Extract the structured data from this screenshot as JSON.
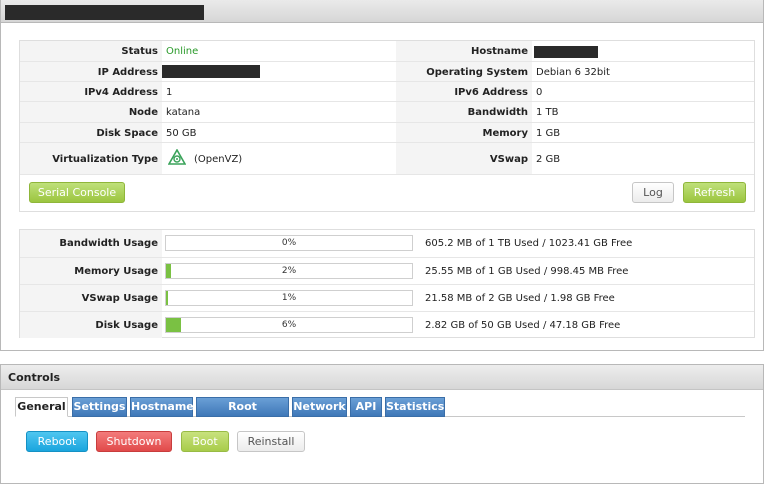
{
  "status": {
    "labels": {
      "status": "Status",
      "ip": "IP Address",
      "ipv4": "IPv4 Address",
      "node": "Node",
      "disk": "Disk Space",
      "virt": "Virtualization Type",
      "hostname": "Hostname",
      "os": "Operating System",
      "ipv6": "IPv6 Address",
      "bandwidth": "Bandwidth",
      "memory": "Memory",
      "vswap": "VSwap"
    },
    "values": {
      "status": "Online",
      "ipv4": "1",
      "node": "katana",
      "disk": "50 GB",
      "virt": "(OpenVZ)",
      "os": "Debian 6 32bit",
      "ipv6": "0",
      "bandwidth": "1 TB",
      "memory": "1 GB",
      "vswap": "2 GB"
    },
    "colors": {
      "online": "#2a9a2a"
    }
  },
  "buttons": {
    "serial_console": "Serial Console",
    "log": "Log",
    "refresh": "Refresh"
  },
  "usage": [
    {
      "label": "Bandwidth Usage",
      "percent_text": "0%",
      "fraction": 0.0,
      "detail": "605.2 MB of 1 TB Used / 1023.41 GB Free"
    },
    {
      "label": "Memory Usage",
      "percent_text": "2%",
      "fraction": 0.02,
      "detail": "25.55 MB of 1 GB Used / 998.45 MB Free"
    },
    {
      "label": "VSwap Usage",
      "percent_text": "1%",
      "fraction": 0.01,
      "detail": "21.58 MB of 2 GB Used / 1.98 GB Free"
    },
    {
      "label": "Disk Usage",
      "percent_text": "6%",
      "fraction": 0.06,
      "detail": "2.82 GB of 50 GB Used / 47.18 GB Free"
    }
  ],
  "controls": {
    "title": "Controls",
    "tabs": [
      "General",
      "Settings",
      "Hostname",
      "Root Password",
      "Network",
      "API",
      "Statistics"
    ],
    "active_tab": "General",
    "actions": [
      "Reboot",
      "Shutdown",
      "Boot",
      "Reinstall"
    ]
  },
  "icons": {
    "virtualization": "openvz-logo-icon"
  }
}
